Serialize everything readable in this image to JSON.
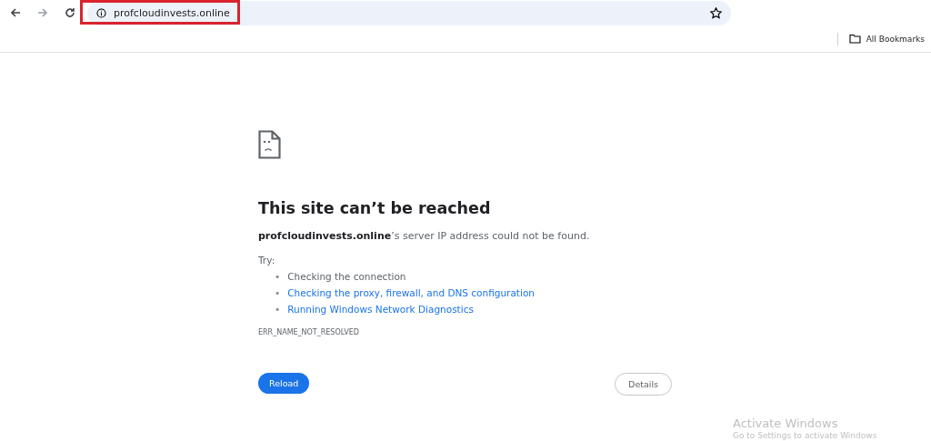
{
  "address_bar": {
    "url": "profcloudinvests.online",
    "highlighted": true
  },
  "bookmarks_bar": {
    "label": "All Bookmarks"
  },
  "error_page": {
    "title": "This site can’t be reached",
    "message": "**profcloudinvests.online**’s server IP address could not be found.",
    "try_label": "Try:",
    "suggestions": [
      {
        "bullet": "•",
        "text": "Checking the connection",
        "kind": "plain"
      },
      {
        "bullet": "•",
        "text": "Checking the proxy, firewall, and DNS configuration",
        "kind": "link"
      },
      {
        "bullet": "•",
        "text": "Running Windows Network Diagnostics",
        "kind": "link"
      }
    ],
    "error_code": "ERR_NAME_NOT_RESOLVED",
    "reload_button": "Reload",
    "details_button": "Details"
  },
  "os_notice": {
    "title": "Activate Windows",
    "subtitle": "Go to Settings to activate Windows"
  }
}
